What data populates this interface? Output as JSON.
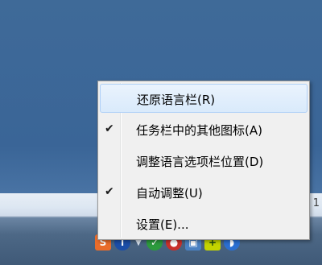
{
  "menu": {
    "items": [
      {
        "label": "还原语言栏(R)",
        "checked": false,
        "highlighted": true
      },
      {
        "label": "任务栏中的其他图标(A)",
        "checked": true,
        "highlighted": false
      },
      {
        "label": "调整语言选项栏位置(D)",
        "checked": false,
        "highlighted": false
      },
      {
        "label": "自动调整(U)",
        "checked": true,
        "highlighted": false
      },
      {
        "label": "设置(E)...",
        "checked": false,
        "highlighted": false
      }
    ],
    "check_glyph": "✔"
  },
  "langbar": {
    "tail_text": "1"
  },
  "tray": {
    "icons": [
      "ime-icon",
      "info-icon",
      "show-hidden-arrow-icon",
      "shield-icon",
      "red-app-icon",
      "network-icon",
      "plus-icon",
      "volume-icon"
    ]
  },
  "colors": {
    "desktop": "#3a6597",
    "menu_bg": "#f0f0f0",
    "highlight": "#d9eafb",
    "highlight_border": "#aecff7"
  }
}
